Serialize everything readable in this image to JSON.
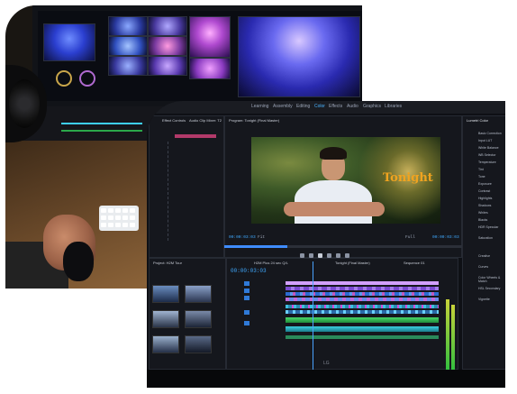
{
  "front_photo": {
    "workspace_tabs": [
      "Learning",
      "Assembly",
      "Editing",
      "Color",
      "Effects",
      "Audio",
      "Graphics",
      "Libraries"
    ],
    "active_tab": "Color",
    "panels": {
      "effect_controls": "Effect Controls",
      "audio_clip_mixer": "Audio Clip Mixer: T2",
      "program": "Program: Tonight (Final Master)",
      "lumetri": "Lumetri Color",
      "project": "Project: H2M Tour",
      "sequence_tab_1": "H2M Plus 24 sec Q/L",
      "sequence_tab_2": "Tonight (Final Master)",
      "sequence_tab_3": "Sequence 01"
    },
    "viewer_title": "Tonight",
    "timecode_current": "00:00:03:03",
    "timecode_end": "00:00:03:03",
    "timeline_timecode": "00:00:03:03",
    "fit_label": "Fit",
    "full_label": "Full",
    "lumetri_sections": [
      "Basic Correction",
      "Input LUT",
      "White Balance",
      "WB Selector",
      "Temperature",
      "Tint",
      "Tone",
      "Exposure",
      "Contrast",
      "Highlights",
      "Shadows",
      "Whites",
      "Blacks",
      "HDR Specular",
      "Saturation",
      "Creative",
      "Curves",
      "Color Wheels & Match",
      "HSL Secondary",
      "Vignette"
    ],
    "brand_logo": "LG"
  },
  "back_photo": {
    "description_tags": [
      "concert-footage",
      "editing-monitor",
      "keyboard",
      "mouse-hand",
      "speaker"
    ]
  },
  "colors": {
    "accent_blue": "#3fa9ff",
    "title_orange": "#f0a31f"
  }
}
